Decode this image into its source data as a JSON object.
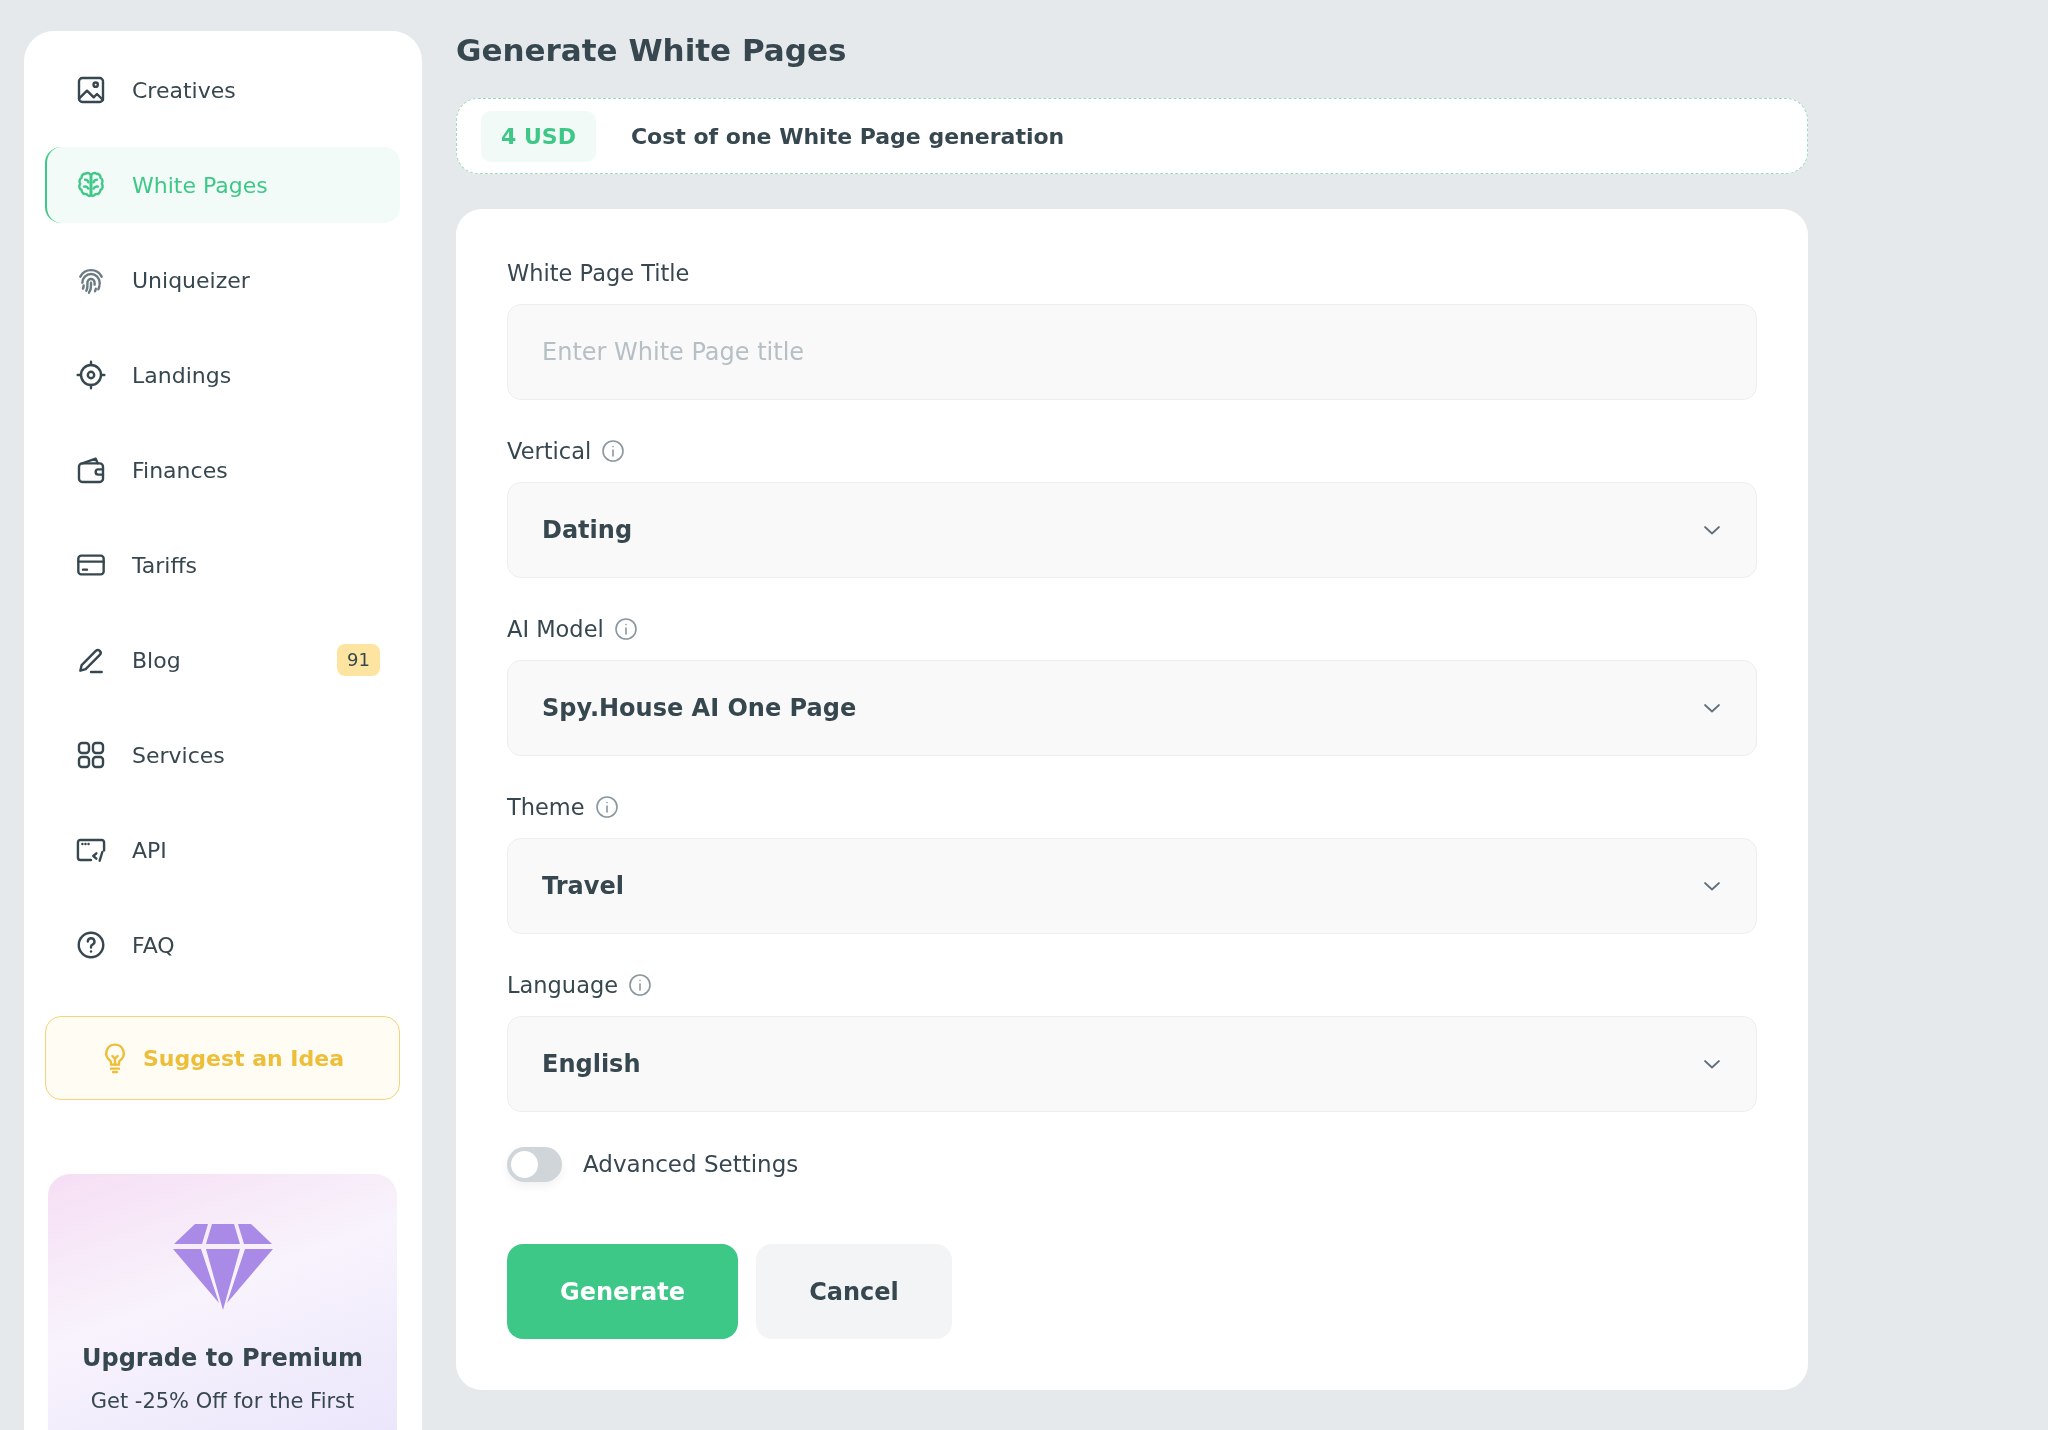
{
  "sidebar": {
    "items": [
      {
        "label": "Creatives",
        "selected": false
      },
      {
        "label": "White Pages",
        "selected": true
      },
      {
        "label": "Uniqueizer",
        "selected": false
      },
      {
        "label": "Landings",
        "selected": false
      },
      {
        "label": "Finances",
        "selected": false
      },
      {
        "label": "Tariffs",
        "selected": false
      },
      {
        "label": "Blog",
        "selected": false,
        "badge": "91"
      },
      {
        "label": "Services",
        "selected": false
      },
      {
        "label": "API",
        "selected": false
      },
      {
        "label": "FAQ",
        "selected": false
      }
    ],
    "suggest_button": "Suggest an Idea",
    "premium_card": {
      "title": "Upgrade to Premium",
      "text": "Get -25% Off for the First"
    }
  },
  "page": {
    "title": "Generate White Pages"
  },
  "cost_banner": {
    "price": "4 USD",
    "text": "Cost of one White Page generation"
  },
  "form": {
    "fields": [
      {
        "kind": "text",
        "label": "White Page Title",
        "placeholder": "Enter White Page title",
        "info": false
      },
      {
        "kind": "select",
        "label": "Vertical",
        "value": "Dating",
        "info": true
      },
      {
        "kind": "select",
        "label": "AI Model",
        "value": "Spy.House AI One Page",
        "info": true
      },
      {
        "kind": "select",
        "label": "Theme",
        "value": "Travel",
        "info": true
      },
      {
        "kind": "select",
        "label": "Language",
        "value": "English",
        "info": true
      }
    ],
    "advanced_settings": {
      "label": "Advanced Settings",
      "on": false
    },
    "buttons": [
      {
        "label": "Generate",
        "kind": "primary"
      },
      {
        "label": "Cancel",
        "kind": "secondary"
      }
    ]
  }
}
